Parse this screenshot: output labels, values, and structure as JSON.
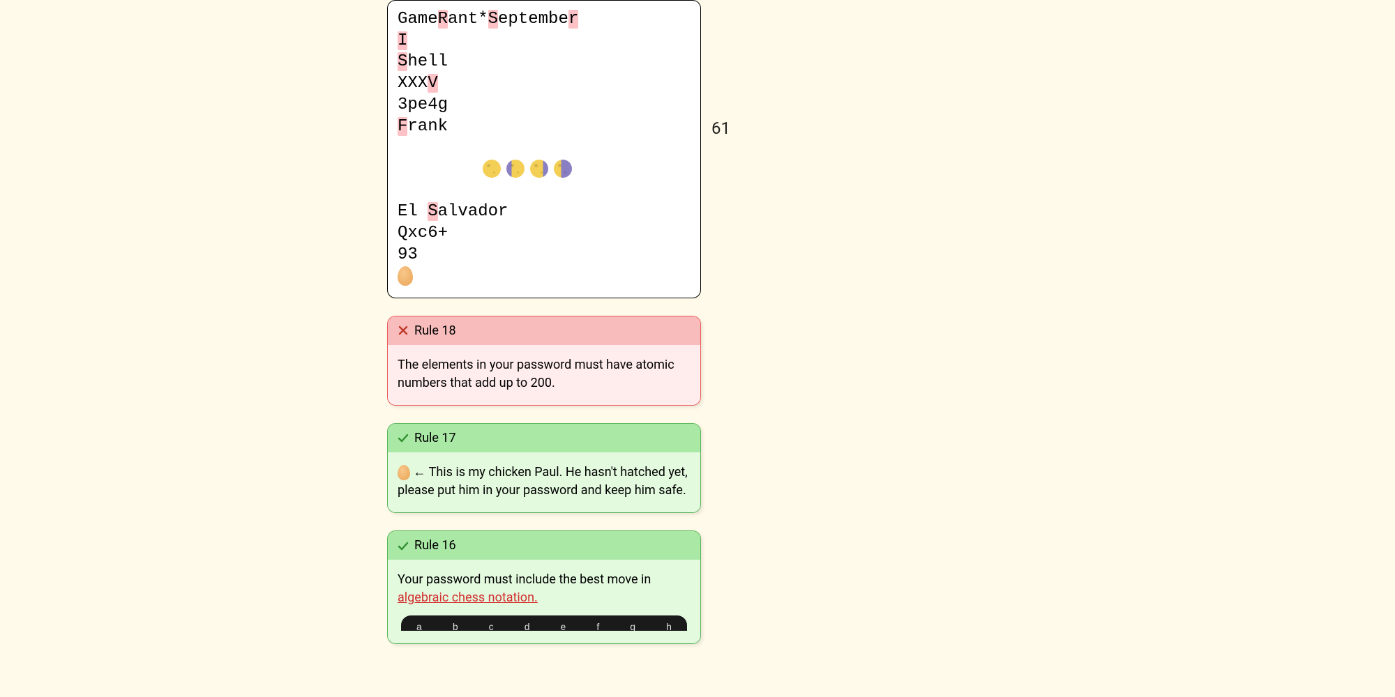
{
  "char_count": "61",
  "password_lines": {
    "l0_a": "Game",
    "l0_b": "R",
    "l0_c": "ant*",
    "l0_d": "S",
    "l0_e": "eptembe",
    "l0_f": "r",
    "l1": "I",
    "l2_a": "S",
    "l2_b": "hell",
    "l3_a": "XXX",
    "l3_b": "V",
    "l4": "3pe4g",
    "l5_a": "F",
    "l5_b": "rank",
    "l7_a": "El ",
    "l7_b": "S",
    "l7_c": "alvador",
    "l8": "Qxc6+",
    "l9": "93"
  },
  "rules": {
    "r18": {
      "label": "Rule 18",
      "text": "The elements in your password must have atomic numbers that add up to 200."
    },
    "r17": {
      "label": "Rule 17",
      "text_after_egg": " ← This is my chicken Paul. He hasn't hatched yet, please put him in your password and keep him safe."
    },
    "r16": {
      "label": "Rule 16",
      "text_before_link": "Your password must include the best move in ",
      "link_text": "algebraic chess notation."
    }
  },
  "chess_files": {
    "a": "a",
    "b": "b",
    "c": "c",
    "d": "d",
    "e": "e",
    "f": "f",
    "g": "g",
    "h": "h"
  }
}
